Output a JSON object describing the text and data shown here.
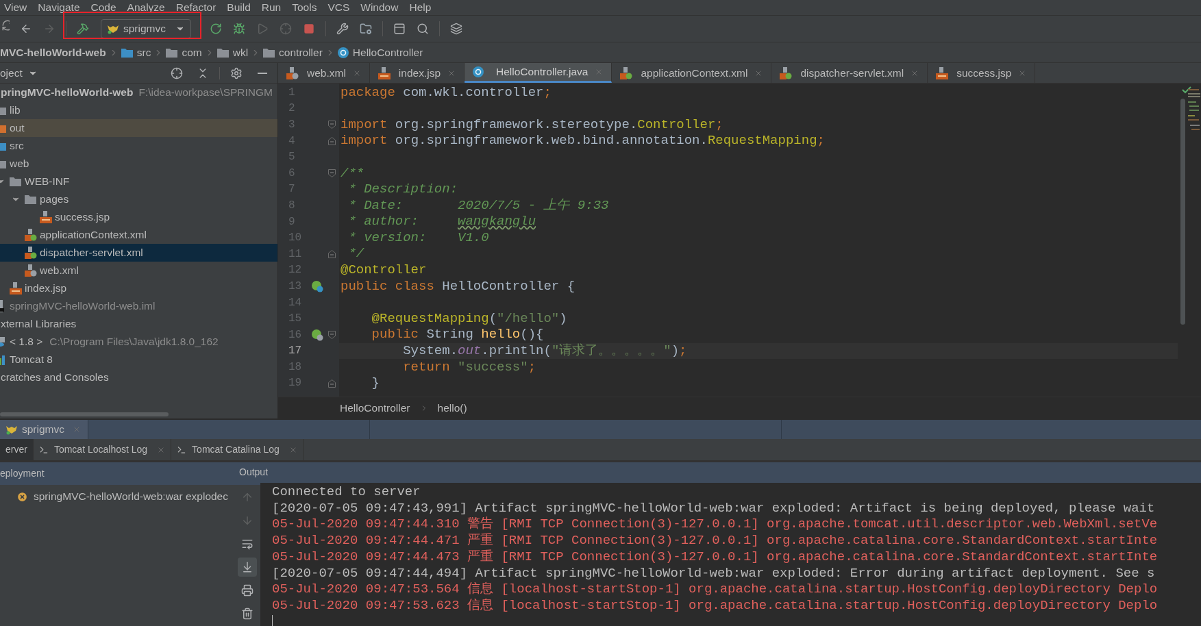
{
  "menu": [
    "View",
    "Navigate",
    "Code",
    "Analyze",
    "Refactor",
    "Build",
    "Run",
    "Tools",
    "VCS",
    "Window",
    "Help"
  ],
  "toolbar": {
    "run_config": {
      "name": "sprigmvc",
      "framed": true
    }
  },
  "breadcrumb": [
    {
      "label": "MVC-helloWorld-web",
      "kind": "module"
    },
    {
      "label": "src",
      "kind": "source-folder"
    },
    {
      "label": "com",
      "kind": "folder"
    },
    {
      "label": "wkl",
      "kind": "folder"
    },
    {
      "label": "controller",
      "kind": "folder"
    },
    {
      "label": "HelloController",
      "kind": "class"
    }
  ],
  "project_panel": {
    "title": "oject",
    "tree": [
      {
        "label": "pringMVC-helloWorld-web",
        "path": "F:\\idea-workpase\\SPRINGM",
        "kind": "module",
        "selected": false,
        "excluded": false,
        "children": [
          {
            "label": "lib",
            "kind": "folder",
            "selected": false,
            "excluded": false
          },
          {
            "label": "out",
            "kind": "folder-excluded",
            "selected": false,
            "excluded": true
          },
          {
            "label": "src",
            "kind": "folder-source",
            "selected": false,
            "excluded": false
          },
          {
            "label": "web",
            "kind": "folder",
            "selected": false,
            "excluded": false,
            "children": [
              {
                "label": "WEB-INF",
                "kind": "folder",
                "selected": false,
                "excluded": false,
                "expanded": true,
                "children": [
                  {
                    "label": "pages",
                    "kind": "folder",
                    "selected": false,
                    "excluded": false,
                    "expanded": true,
                    "children": [
                      {
                        "label": "success.jsp",
                        "kind": "jsp",
                        "selected": false,
                        "excluded": false
                      }
                    ]
                  },
                  {
                    "label": "applicationContext.xml",
                    "kind": "spring-xml",
                    "selected": false,
                    "excluded": false
                  },
                  {
                    "label": "dispatcher-servlet.xml",
                    "kind": "spring-xml",
                    "selected": true,
                    "excluded": false
                  },
                  {
                    "label": "web.xml",
                    "kind": "web-xml",
                    "selected": false,
                    "excluded": false
                  }
                ]
              },
              {
                "label": "index.jsp",
                "kind": "jsp",
                "selected": false,
                "excluded": false
              }
            ]
          },
          {
            "label": "springMVC-helloWorld-web.iml",
            "kind": "iml",
            "selected": false,
            "excluded": false
          }
        ]
      },
      {
        "label": "xternal Libraries",
        "kind": "library",
        "selected": false,
        "excluded": false,
        "children": [
          {
            "label": "< 1.8 >",
            "path": "C:\\Program Files\\Java\\jdk1.8.0_162",
            "kind": "jdk",
            "selected": false,
            "excluded": false
          },
          {
            "label": "Tomcat 8",
            "kind": "tomcat-lib",
            "selected": false,
            "excluded": false
          }
        ]
      },
      {
        "label": "cratches and Consoles",
        "kind": "scratch",
        "selected": false,
        "excluded": false
      }
    ]
  },
  "editor_tabs": [
    {
      "label": "web.xml",
      "kind": "web-xml",
      "selected": false
    },
    {
      "label": "index.jsp",
      "kind": "jsp",
      "selected": false
    },
    {
      "label": "HelloController.java",
      "kind": "class",
      "selected": true
    },
    {
      "label": "applicationContext.xml",
      "kind": "spring-xml",
      "selected": false
    },
    {
      "label": "dispatcher-servlet.xml",
      "kind": "spring-xml",
      "selected": false
    },
    {
      "label": "success.jsp",
      "kind": "jsp",
      "selected": false
    }
  ],
  "code": {
    "lines": [
      {
        "number": "1",
        "current": false,
        "tokens": [
          {
            "kind": "keyword",
            "text": "package"
          },
          {
            "kind": "plain",
            "text": " com.wkl.controller"
          },
          {
            "kind": "keyword",
            "text": ";"
          }
        ]
      },
      {
        "number": "2",
        "current": false
      },
      {
        "number": "3",
        "current": false,
        "gutter_icons": [
          {
            "kind": "fold-open"
          }
        ],
        "tokens": [
          {
            "kind": "keyword",
            "text": "import"
          },
          {
            "kind": "plain",
            "text": " org.springframework.stereotype."
          },
          {
            "kind": "annotation",
            "text": "Controller"
          },
          {
            "kind": "keyword",
            "text": ";"
          }
        ]
      },
      {
        "number": "4",
        "current": false,
        "gutter_icons": [
          {
            "kind": "fold-close"
          }
        ],
        "tokens": [
          {
            "kind": "keyword",
            "text": "import"
          },
          {
            "kind": "plain",
            "text": " org.springframework.web.bind.annotation."
          },
          {
            "kind": "annotation",
            "text": "RequestMapping"
          },
          {
            "kind": "keyword",
            "text": ";"
          }
        ]
      },
      {
        "number": "5",
        "current": false
      },
      {
        "number": "6",
        "current": false,
        "gutter_icons": [
          {
            "kind": "fold-open"
          }
        ],
        "tokens": [
          {
            "kind": "comment",
            "text": "/**"
          }
        ]
      },
      {
        "number": "7",
        "current": false,
        "tokens": [
          {
            "kind": "comment",
            "text": " * Description:"
          }
        ]
      },
      {
        "number": "8",
        "current": false,
        "tokens": [
          {
            "kind": "comment",
            "text": " * Date:       2020/7/5 - 上午 9:33"
          }
        ]
      },
      {
        "number": "9",
        "current": false,
        "tokens": [
          {
            "kind": "comment",
            "text": " * author:     "
          },
          {
            "kind": "comment-typo",
            "text": "wangkanglu"
          }
        ]
      },
      {
        "number": "10",
        "current": false,
        "tokens": [
          {
            "kind": "comment",
            "text": " * version:    V1.0"
          }
        ]
      },
      {
        "number": "11",
        "current": false,
        "gutter_icons": [
          {
            "kind": "fold-close"
          }
        ],
        "tokens": [
          {
            "kind": "comment",
            "text": " */"
          }
        ]
      },
      {
        "number": "12",
        "current": false,
        "tokens": [
          {
            "kind": "annotation",
            "text": "@Controller"
          }
        ]
      },
      {
        "number": "13",
        "current": false,
        "gutter_icons": [
          {
            "kind": "bean-class"
          }
        ],
        "tokens": [
          {
            "kind": "keyword",
            "text": "public class"
          },
          {
            "kind": "plain",
            "text": " HelloController {"
          }
        ]
      },
      {
        "number": "14",
        "current": false
      },
      {
        "number": "15",
        "current": false,
        "tokens": [
          {
            "kind": "annotation",
            "text": "    @RequestMapping"
          },
          {
            "kind": "plain",
            "text": "("
          },
          {
            "kind": "string",
            "text": "\"/hello\""
          },
          {
            "kind": "plain",
            "text": ")"
          }
        ]
      },
      {
        "number": "16",
        "current": false,
        "gutter_icons": [
          {
            "kind": "bean-web"
          },
          {
            "kind": "fold-open"
          }
        ],
        "tokens": [
          {
            "kind": "keyword",
            "text": "    public"
          },
          {
            "kind": "plain",
            "text": " String "
          },
          {
            "kind": "method",
            "text": "hello"
          },
          {
            "kind": "plain",
            "text": "(){"
          }
        ]
      },
      {
        "number": "17",
        "current": true,
        "tokens": [
          {
            "kind": "plain",
            "text": "        System."
          },
          {
            "kind": "field",
            "text": "out"
          },
          {
            "kind": "plain",
            "text": ".println("
          },
          {
            "kind": "string",
            "text": "\"请求了。。。。。\""
          },
          {
            "kind": "plain",
            "text": ")"
          },
          {
            "kind": "keyword",
            "text": ";"
          }
        ]
      },
      {
        "number": "18",
        "current": false,
        "tokens": [
          {
            "kind": "keyword",
            "text": "        return"
          },
          {
            "kind": "string",
            "text": " \"success\""
          },
          {
            "kind": "keyword",
            "text": ";"
          }
        ]
      },
      {
        "number": "19",
        "current": false,
        "gutter_icons": [
          {
            "kind": "fold-close"
          }
        ],
        "tokens": [
          {
            "kind": "plain",
            "text": "    }"
          }
        ]
      }
    ]
  },
  "editor_breadcrumb": [
    "HelloController",
    "hello()"
  ],
  "run_window": {
    "tabs": [
      {
        "label": "sprigmvc",
        "selected": true
      }
    ],
    "sub_tabs": [
      {
        "label": "erver",
        "selected": true,
        "closable": false
      },
      {
        "label": "Tomcat Localhost Log",
        "selected": false,
        "closable": true
      },
      {
        "label": "Tomcat Catalina Log",
        "selected": false,
        "closable": true
      }
    ],
    "deployment_header": "eployment",
    "output_header": "Output",
    "deployments": [
      {
        "label": "springMVC-helloWorld-web:war explodec",
        "kind": "error"
      }
    ],
    "output": [
      {
        "kind": "info",
        "text": "Connected to server"
      },
      {
        "kind": "info",
        "text": "[2020-07-05 09:47:43,991] Artifact springMVC-helloWorld-web:war exploded: Artifact is being deployed, please wait"
      },
      {
        "kind": "error",
        "text": "05-Jul-2020 09:47:44.310 警告 [RMI TCP Connection(3)-127.0.0.1] org.apache.tomcat.util.descriptor.web.WebXml.setVe"
      },
      {
        "kind": "error",
        "text": "05-Jul-2020 09:47:44.471 严重 [RMI TCP Connection(3)-127.0.0.1] org.apache.catalina.core.StandardContext.startInte"
      },
      {
        "kind": "error",
        "text": "05-Jul-2020 09:47:44.473 严重 [RMI TCP Connection(3)-127.0.0.1] org.apache.catalina.core.StandardContext.startInte"
      },
      {
        "kind": "info",
        "text": "[2020-07-05 09:47:44,494] Artifact springMVC-helloWorld-web:war exploded: Error during artifact deployment. See s"
      },
      {
        "kind": "error",
        "text": "05-Jul-2020 09:47:53.564 信息 [localhost-startStop-1] org.apache.catalina.startup.HostConfig.deployDirectory Deplo"
      },
      {
        "kind": "error",
        "text": "05-Jul-2020 09:47:53.623 信息 [localhost-startStop-1] org.apache.catalina.startup.HostConfig.deployDirectory Deplo"
      }
    ]
  }
}
